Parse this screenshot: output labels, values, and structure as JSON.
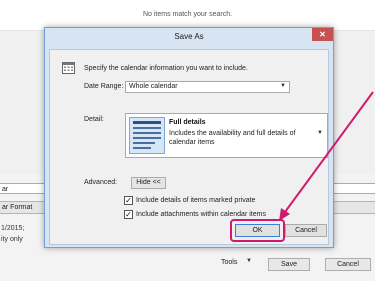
{
  "background": {
    "top_message": "No items match your search.",
    "left_combo_text": "ar",
    "left_tab_text": "ar Format",
    "left_date_text": "1/2015;",
    "left_status_text": "ity only",
    "tools_label": "Tools",
    "save_label": "Save",
    "cancel_label": "Cancel"
  },
  "dialog": {
    "title": "Save As",
    "close_glyph": "✕",
    "intro": "Specify the calendar information you want to include.",
    "date_range": {
      "label": "Date Range:",
      "value": "Whole calendar"
    },
    "detail": {
      "label": "Detail:",
      "title": "Full details",
      "description": "Includes the availability and full details of calendar items"
    },
    "advanced": {
      "label": "Advanced:",
      "hide_button": "Hide <<"
    },
    "options": [
      {
        "label": "Include details of items marked private",
        "checked": true
      },
      {
        "label": "Include attachments within calendar items",
        "checked": true
      }
    ],
    "ok_label": "OK",
    "cancel_label": "Cancel"
  },
  "colors": {
    "highlight": "#d11a6e",
    "dialog_frame": "#d7e4f2",
    "close_button": "#c75050"
  },
  "icons": {
    "calendar": "calendar-icon",
    "detail": "full-details-icon",
    "dropdown": "chevron-down-icon",
    "close": "close-icon"
  }
}
